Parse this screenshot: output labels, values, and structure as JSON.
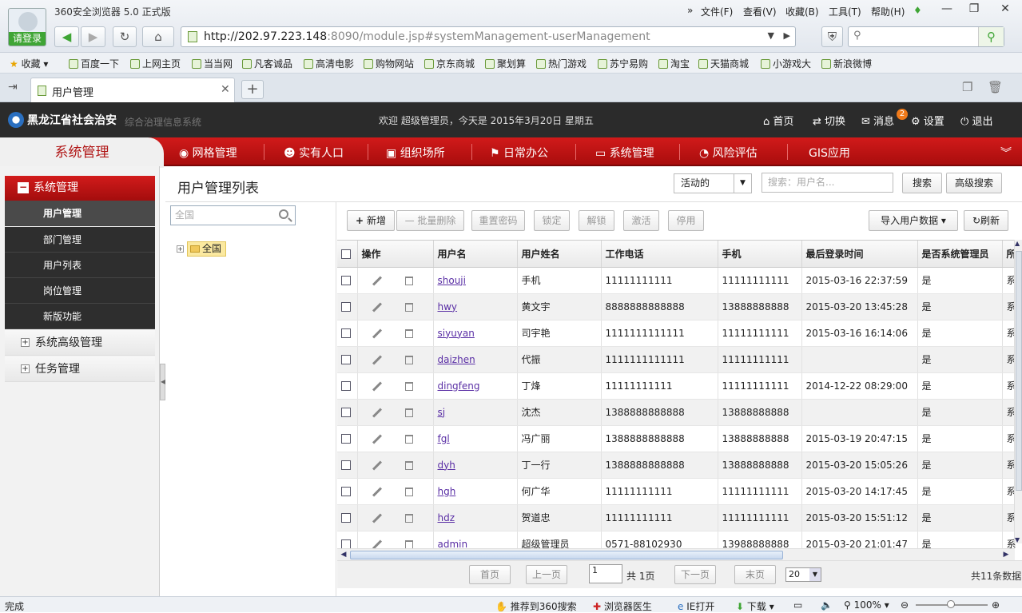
{
  "browser": {
    "guest_label": "请登录",
    "title": "360安全浏览器 5.0 正式版",
    "menus": [
      "文件(F)",
      "查看(V)",
      "收藏(B)",
      "工具(T)",
      "帮助(H)"
    ],
    "address_host": "http://202.97.223.148",
    "address_rest": ":8090/module.jsp#systemManagement-userManagement",
    "bookmarks": [
      "收藏",
      "百度一下",
      "上网主页",
      "当当网",
      "凡客诚品",
      "高清电影",
      "购物网站",
      "京东商城",
      "聚划算",
      "热门游戏",
      "苏宁易购",
      "淘宝",
      "天猫商城",
      "小游戏大",
      "新浪微博"
    ],
    "tab_label": "用户管理"
  },
  "header": {
    "logo": "黑龙江省社会治安",
    "logo_sub": "综合治理信息系统",
    "welcome": "欢迎 超级管理员，今天是 2015年3月20日 星期五",
    "links": [
      "首页",
      "切换",
      "消息",
      "设置",
      "退出"
    ],
    "msg_count": "2"
  },
  "nav": {
    "current": "系统管理",
    "items": [
      "网格管理",
      "实有人口",
      "组织场所",
      "日常办公",
      "系统管理",
      "风险评估",
      "GIS应用"
    ]
  },
  "sidebar": {
    "head": "系统管理",
    "subs": [
      "用户管理",
      "部门管理",
      "用户列表",
      "岗位管理",
      "新版功能"
    ],
    "groups": [
      "系统高级管理",
      "任务管理"
    ]
  },
  "content": {
    "title": "用户管理列表",
    "status_value": "活动的",
    "search_placeholder": "搜索：用户名...",
    "search_btn": "搜索",
    "adv_btn": "高级搜索",
    "tree_search_placeholder": "全国",
    "tree_root": "全国",
    "toolbar": {
      "add": "新增",
      "batch_delete": "批量删除",
      "reset_pwd": "重置密码",
      "lock": "锁定",
      "unlock": "解锁",
      "activate": "激活",
      "disable": "停用",
      "import": "导入用户数据",
      "refresh": "刷新"
    },
    "columns": [
      "操作",
      "用户名",
      "用户姓名",
      "工作电话",
      "手机",
      "最后登录时间",
      "是否系统管理员",
      "所在"
    ],
    "rows": [
      [
        "shouji",
        "手机",
        "11111111111",
        "11111111111",
        "2015-03-16 22:37:59",
        "是",
        "系"
      ],
      [
        "hwy",
        "黄文宇",
        "8888888888888",
        "13888888888",
        "2015-03-20 13:45:28",
        "是",
        "系"
      ],
      [
        "siyuyan",
        "司宇艳",
        "1111111111111",
        "11111111111",
        "2015-03-16 16:14:06",
        "是",
        "系"
      ],
      [
        "daizhen",
        "代振",
        "1111111111111",
        "11111111111",
        "",
        "是",
        "系"
      ],
      [
        "dingfeng",
        "丁烽",
        "11111111111",
        "11111111111",
        "2014-12-22 08:29:00",
        "是",
        "系"
      ],
      [
        "sj",
        "沈杰",
        "1388888888888",
        "13888888888",
        "",
        "是",
        "系"
      ],
      [
        "fgl",
        "冯广丽",
        "1388888888888",
        "13888888888",
        "2015-03-19 20:47:15",
        "是",
        "系"
      ],
      [
        "dyh",
        "丁一行",
        "1388888888888",
        "13888888888",
        "2015-03-20 15:05:26",
        "是",
        "系"
      ],
      [
        "hgh",
        "何广华",
        "11111111111",
        "11111111111",
        "2015-03-20 14:17:45",
        "是",
        "系"
      ],
      [
        "hdz",
        "贺道忠",
        "11111111111",
        "11111111111",
        "2015-03-20 15:51:12",
        "是",
        "系"
      ],
      [
        "admin",
        "超级管理员",
        "0571-88102930",
        "13988888888",
        "2015-03-20 21:01:47",
        "是",
        "系"
      ]
    ],
    "pager": {
      "first": "首页",
      "prev": "上一页",
      "page": "1",
      "total_pages": "共 1页",
      "next": "下一页",
      "last": "末页",
      "size": "20",
      "total_count": "共11条数据"
    }
  },
  "statusbar": {
    "done": "完成",
    "items": [
      "推荐到360搜索",
      "浏览器医生",
      "IE打开",
      "下载"
    ],
    "zoom": "100%"
  },
  "colors": {
    "nav_red": "#c31414",
    "header_dark": "#2b2b2b",
    "link_purple": "#5a2fa5"
  }
}
